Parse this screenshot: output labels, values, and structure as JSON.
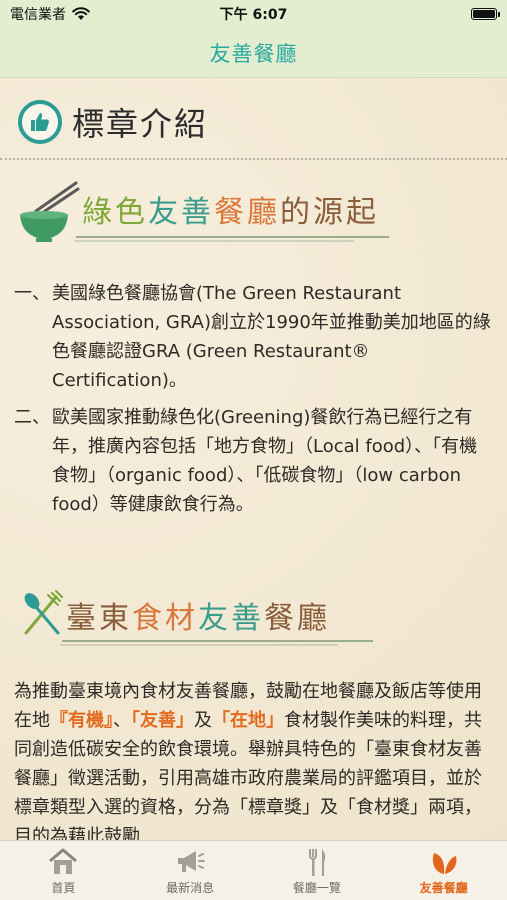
{
  "status_bar": {
    "carrier": "電信業者",
    "time": "下午 6:07"
  },
  "nav": {
    "title": "友善餐廳"
  },
  "section": {
    "title": "標章介紹"
  },
  "origin": {
    "heading_parts": [
      "綠色",
      "友善",
      "餐廳",
      "的源起"
    ],
    "items": [
      {
        "num": "一、",
        "text": "美國綠色餐廳協會(The Green Restaurant Association, GRA)創立於1990年並推動美加地區的綠色餐廳認證GRA (Green Restaurant® Certification)。"
      },
      {
        "num": "二、",
        "text": "歐美國家推動綠色化(Greening)餐飲行為已經行之有年，推廣內容包括「地方食物」（Local food）、「有機食物」（organic food）、「低碳食物」（low carbon food）等健康飲食行為。"
      }
    ]
  },
  "local": {
    "heading_parts": [
      "臺東",
      "食材",
      "友善",
      "餐廳"
    ],
    "p1": "為推動臺東境內食材友善餐廳，鼓勵在地餐廳及飯店等使用在地",
    "h1": "『有機』",
    "s1": "、",
    "h2": "「友善」",
    "s2": "及",
    "h3": "「在地」",
    "p2": "食材製作美味的料理，共同創造低碳安全的飲食環境。舉辦具特色的「臺東食材友善餐廳」徵選活動，引用高雄市政府農業局的評鑑項目，並於標章類型入選的資格，分為「標章獎」及「食材獎」兩項，目的為藉此鼓勵"
  },
  "tabs": [
    {
      "label": "首頁",
      "icon": "home-icon",
      "active": false
    },
    {
      "label": "最新消息",
      "icon": "megaphone-icon",
      "active": false
    },
    {
      "label": "餐廳一覽",
      "icon": "fork-knife-icon",
      "active": false
    },
    {
      "label": "友善餐廳",
      "icon": "leaf-icon",
      "active": true
    }
  ],
  "colors": {
    "accent_teal": "#2aa9a0",
    "active_tab": "#e2671d",
    "highlight": "#e26b1f",
    "background": "#f3ead6"
  }
}
